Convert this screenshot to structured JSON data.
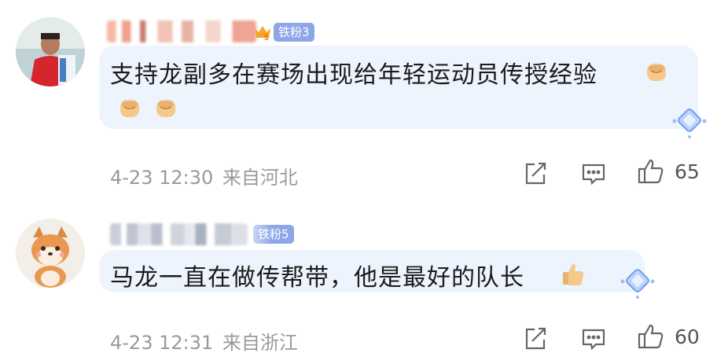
{
  "comments": [
    {
      "fan_badge": "铁粉3",
      "text": "支持龙副多在赛场出现给年轻运动员传授经验",
      "time": "4-23 12:30",
      "location": "来自河北",
      "likes": "65",
      "emoji": "fist-emoji"
    },
    {
      "fan_badge": "铁粉5",
      "text": "马龙一直在做传帮带，他是最好的队长",
      "time": "4-23 12:31",
      "location": "来自浙江",
      "likes": "60",
      "emoji": "thumbs-up-emoji"
    }
  ]
}
